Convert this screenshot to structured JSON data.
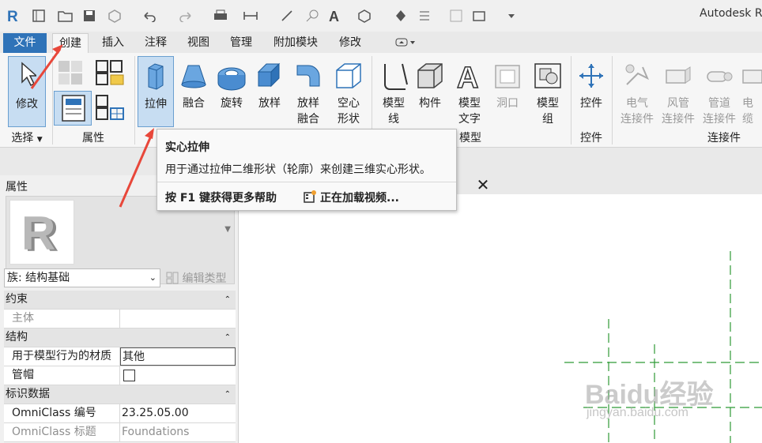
{
  "app": {
    "title": "Autodesk R"
  },
  "tabs": [
    {
      "label": "文件"
    },
    {
      "label": "创建"
    },
    {
      "label": "插入"
    },
    {
      "label": "注释"
    },
    {
      "label": "视图"
    },
    {
      "label": "管理"
    },
    {
      "label": "附加模块"
    },
    {
      "label": "修改"
    }
  ],
  "ribbon": {
    "buttons": {
      "modify": "修改",
      "extrusion": "拉伸",
      "blend": "融合",
      "revolve": "旋转",
      "sweep": "放样",
      "swept_blend": "放样\n融合",
      "void_forms": "空心\n形状",
      "model_line": "模型\n线",
      "component": "构件",
      "model_text": "模型\n文字",
      "opening": "洞口",
      "model_group": "模型\n组",
      "control": "控件",
      "electrical_connector": "电气\n连接件",
      "duct_connector": "风管\n连接件",
      "pipe_connector": "管道\n连接件",
      "cable_tray_connector": "电缆\n连接件"
    },
    "panels": {
      "select": "选择",
      "properties": "属性",
      "model": "模型",
      "control": "控件",
      "connectors": "连接件"
    }
  },
  "tooltip": {
    "title": "实心拉伸",
    "description": "用于通过拉伸二维形状（轮廓）来创建三维实心形状。",
    "help": "按 F1 键获得更多帮助",
    "video": "正在加载视频..."
  },
  "properties": {
    "title": "属性",
    "family_selector": "族: 结构基础",
    "edit_type": "编辑类型",
    "groups": [
      {
        "name": "约束",
        "rows": [
          {
            "key": "主体",
            "value": "",
            "dim": true
          }
        ]
      },
      {
        "name": "结构",
        "rows": [
          {
            "key": "用于模型行为的材质",
            "value": "其他",
            "editing": true
          },
          {
            "key": "管帽",
            "value": "",
            "checkbox": true
          }
        ]
      },
      {
        "name": "标识数据",
        "rows": [
          {
            "key": "OmniClass 编号",
            "value": "23.25.05.00"
          },
          {
            "key": "OmniClass 标题",
            "value": "Foundations",
            "dim": true
          }
        ]
      }
    ]
  },
  "view": {
    "close_label": "✕"
  },
  "watermark": {
    "text": "Baidu经验",
    "sub": "jingyan.baidu.com"
  },
  "colors": {
    "file_tab": "#2f73b8",
    "highlight": "#c7ddf2",
    "annotation_arrow": "#e8473a",
    "ref_line": "#2f9a36"
  }
}
